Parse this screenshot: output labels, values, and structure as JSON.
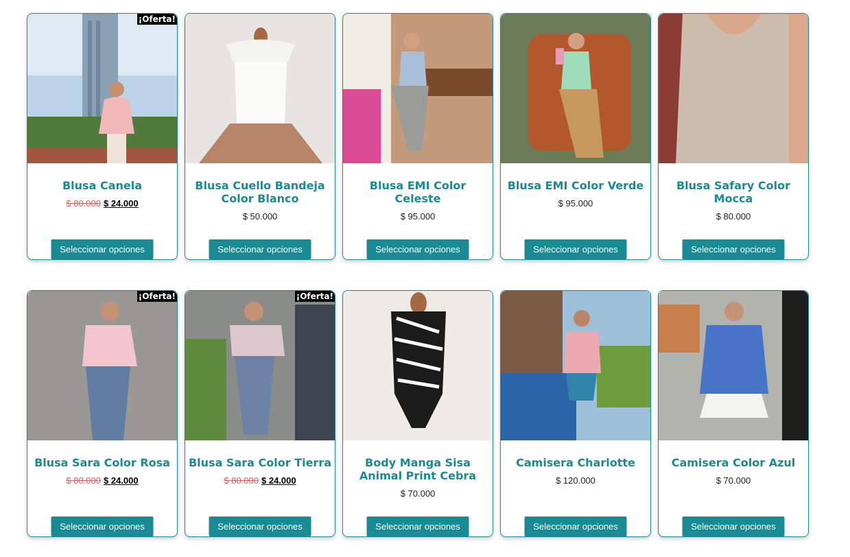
{
  "ui": {
    "accent": "#1a8a94",
    "button_label": "Seleccionar opciones",
    "sale_badge": "¡Oferta!"
  },
  "products": [
    {
      "name": "Blusa Canela",
      "on_sale": true,
      "old_price": "$ 80.000",
      "price": "$ 24.000",
      "image": "woman-pink-blouse-city"
    },
    {
      "name": "Blusa Cuello Bandeja Color Blanco",
      "on_sale": false,
      "old_price": "",
      "price": "$ 50.000",
      "image": "white-blouse-mannequin"
    },
    {
      "name": "Blusa EMI Color Celeste",
      "on_sale": false,
      "old_price": "",
      "price": "$ 95.000",
      "image": "woman-blue-vest-cafe"
    },
    {
      "name": "Blusa EMI Color Verde",
      "on_sale": false,
      "old_price": "",
      "price": "$ 95.000",
      "image": "woman-green-vest-armchair"
    },
    {
      "name": "Blusa Safary Color Mocca",
      "on_sale": false,
      "old_price": "",
      "price": "$ 80.000",
      "image": "mocca-tank-top-closeup"
    },
    {
      "name": "Blusa Sara Color Rosa",
      "on_sale": true,
      "old_price": "$ 80.000",
      "price": "$ 24.000",
      "image": "woman-pink-satin-blouse"
    },
    {
      "name": "Blusa Sara Color Tierra",
      "on_sale": true,
      "old_price": "$ 80.000",
      "price": "$ 24.000",
      "image": "woman-taupe-blouse"
    },
    {
      "name": "Body Manga Sisa Animal Print Cebra",
      "on_sale": false,
      "old_price": "",
      "price": "$ 70.000",
      "image": "zebra-bodysuit-mannequin"
    },
    {
      "name": "Camisera Charlotte",
      "on_sale": false,
      "old_price": "",
      "price": "$ 120.000",
      "image": "woman-pink-shirt-pool"
    },
    {
      "name": "Camisera Color Azul",
      "on_sale": false,
      "old_price": "",
      "price": "$ 70.000",
      "image": "woman-blue-shirt-white-skirt"
    }
  ]
}
